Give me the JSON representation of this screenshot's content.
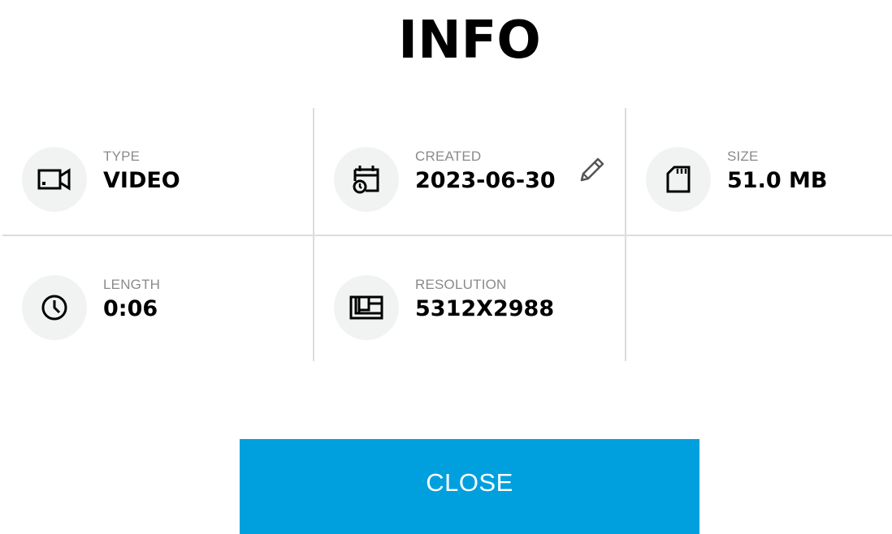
{
  "title": "INFO",
  "items": [
    {
      "label": "TYPE",
      "value": "VIDEO",
      "icon": "video-camera-icon"
    },
    {
      "label": "CREATED",
      "value": "2023-06-30",
      "icon": "calendar-clock-icon",
      "edit_icon": "pencil-icon"
    },
    {
      "label": "SIZE",
      "value": "51.0 MB",
      "icon": "sd-card-icon"
    },
    {
      "label": "LENGTH",
      "value": "0:06",
      "icon": "clock-icon"
    },
    {
      "label": "RESOLUTION",
      "value": "5312X2988",
      "icon": "resolution-icon"
    }
  ],
  "close_label": "CLOSE",
  "colors": {
    "accent": "#00a0df",
    "icon_background": "#f1f2f2",
    "label": "#8a8a8a",
    "divider": "#dcdcdc"
  }
}
